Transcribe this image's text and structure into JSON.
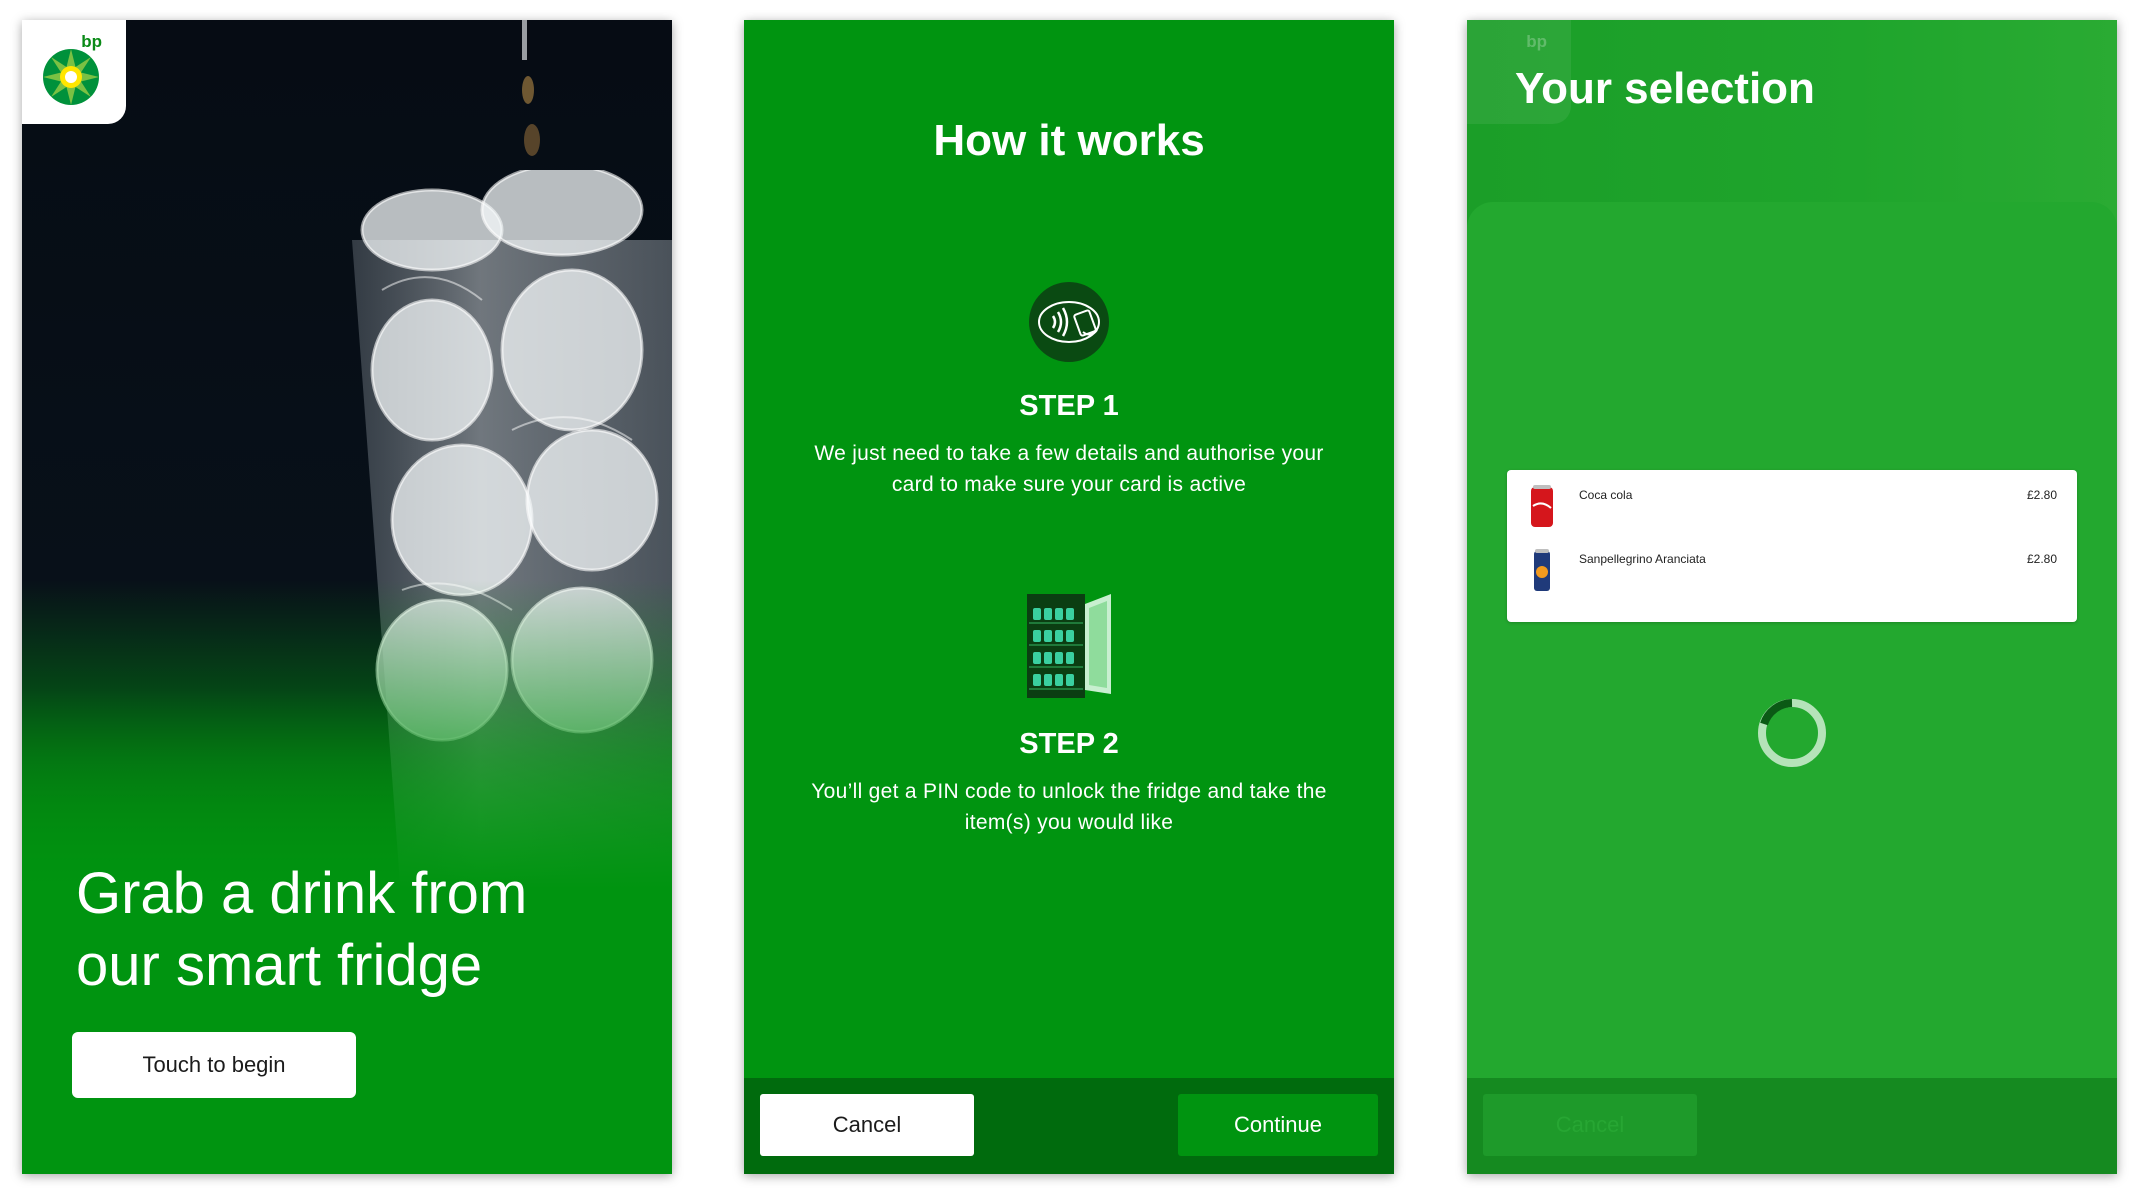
{
  "screen1": {
    "logo_text": "bp",
    "headline": "Grab a drink from our smart fridge",
    "begin_label": "Touch to begin"
  },
  "screen2": {
    "title": "How it works",
    "steps": [
      {
        "heading": "STEP 1",
        "text": "We just need to take a few details and authorise your card to make sure your card is active",
        "icon": "contactless-card-icon"
      },
      {
        "heading": "STEP 2",
        "text": "You’ll get a PIN code to unlock the fridge and take the item(s) you would like",
        "icon": "fridge-icon"
      }
    ],
    "cancel_label": "Cancel",
    "continue_label": "Continue"
  },
  "screen3": {
    "logo_text": "bp",
    "title": "Your selection",
    "items": [
      {
        "name": "Coca cola",
        "price": "£2.80",
        "icon": "cola-can-icon"
      },
      {
        "name": "Sanpellegrino Aranciata",
        "price": "£2.80",
        "icon": "orange-can-icon"
      }
    ],
    "cancel_label": "Cancel",
    "loading_icon": "loading-spinner-icon"
  },
  "colors": {
    "brand_green": "#009410",
    "dark_green": "#006b0d",
    "white": "#ffffff"
  }
}
